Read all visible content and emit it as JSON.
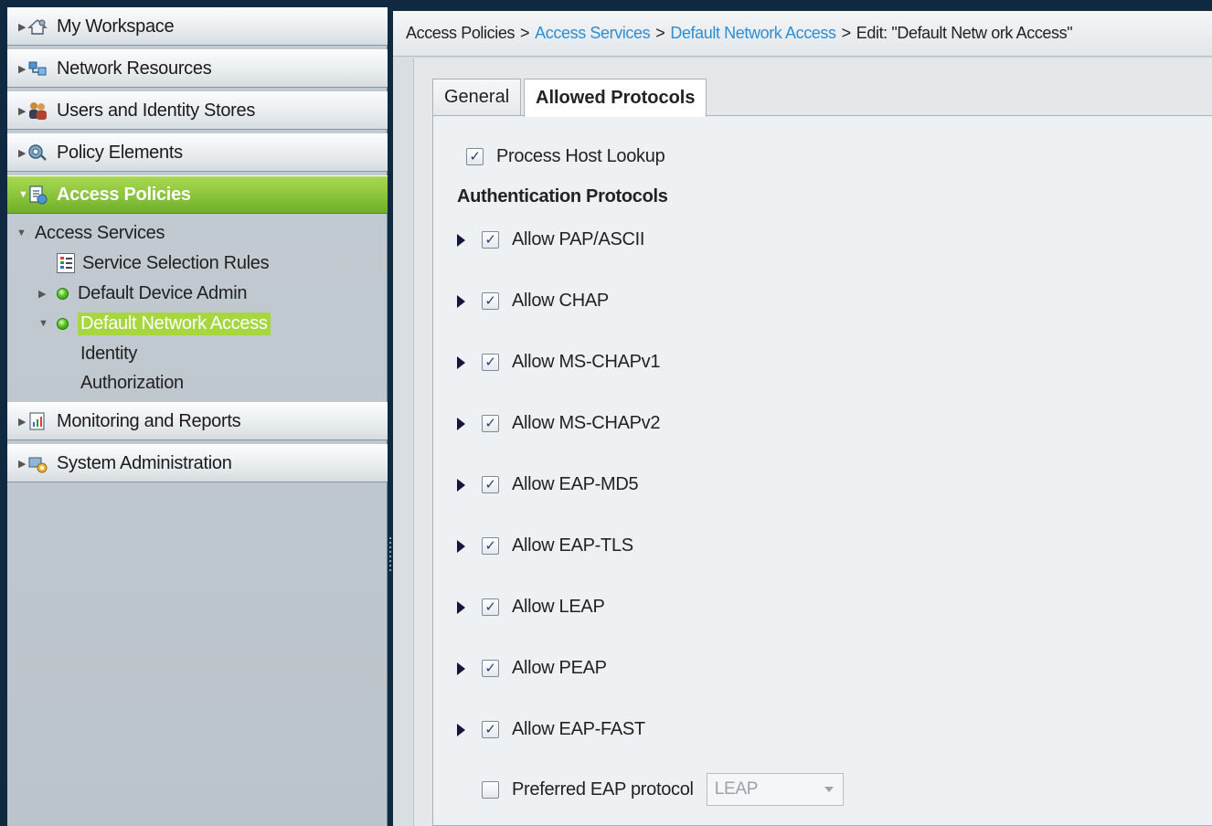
{
  "nav": {
    "sections": [
      {
        "label": "My Workspace",
        "icon": "workspace-icon"
      },
      {
        "label": "Network Resources",
        "icon": "network-resources-icon"
      },
      {
        "label": "Users and Identity Stores",
        "icon": "users-icon"
      },
      {
        "label": "Policy Elements",
        "icon": "policy-elements-icon"
      },
      {
        "label": "Access Policies",
        "icon": "access-policies-icon"
      },
      {
        "label": "Monitoring and Reports",
        "icon": "monitoring-icon"
      },
      {
        "label": "System Administration",
        "icon": "system-admin-icon"
      }
    ],
    "tree": {
      "access_services": "Access Services",
      "service_selection_rules": "Service Selection Rules",
      "default_device_admin": "Default Device Admin",
      "default_network_access": "Default Network Access",
      "identity": "Identity",
      "authorization": "Authorization"
    }
  },
  "breadcrumb": {
    "root": "Access Policies",
    "access_services": "Access Services",
    "default_network_access": "Default Network Access",
    "current": "Edit: \"Default Netw ork Access\"",
    "separator": ">"
  },
  "tabs": {
    "general": "General",
    "allowed_protocols": "Allowed Protocols"
  },
  "form": {
    "process_host_lookup": "Process Host Lookup",
    "auth_protocols_title": "Authentication Protocols",
    "protocols": [
      "Allow PAP/ASCII",
      "Allow CHAP",
      "Allow MS-CHAPv1",
      "Allow MS-CHAPv2",
      "Allow EAP-MD5",
      "Allow EAP-TLS",
      "Allow LEAP",
      "Allow PEAP",
      "Allow EAP-FAST"
    ],
    "preferred_eap_label": "Preferred EAP protocol",
    "preferred_eap_value": "LEAP",
    "check_mark": "✓"
  },
  "colors": {
    "accent_green": "#8cc63e",
    "link_blue": "#2b8ed6",
    "frame_dark": "#0f2a40"
  }
}
